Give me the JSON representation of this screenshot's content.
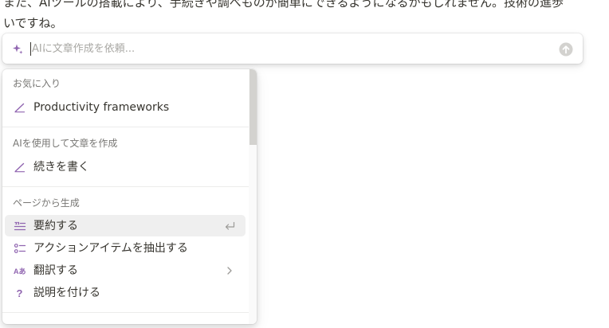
{
  "document": {
    "line1": "また、AIツールの搭載により、手続きや調べものが簡単にできるようになるかもしれません。技術の進歩",
    "line2": "いですね。"
  },
  "ai_bar": {
    "placeholder": "AIに文章作成を依頼...",
    "value": "",
    "icon": "sparkle-icon",
    "send_icon": "arrow-up-circle-icon"
  },
  "menu": {
    "sections": [
      {
        "label": "お気に入り",
        "items": [
          {
            "label": "Productivity frameworks",
            "icon": "pen-icon"
          }
        ]
      },
      {
        "label": "AIを使用して文章を作成",
        "items": [
          {
            "label": "続きを書く",
            "icon": "pen-icon"
          }
        ]
      },
      {
        "label": "ページから生成",
        "items": [
          {
            "label": "要約する",
            "icon": "quote-list-icon",
            "trailing": "enter-icon",
            "active": true
          },
          {
            "label": "アクションアイテムを抽出する",
            "icon": "checklist-icon"
          },
          {
            "label": "翻訳する",
            "icon": "translate-icon",
            "trailing": "chevron-right-icon"
          },
          {
            "label": "説明を付ける",
            "icon": "question-icon"
          }
        ]
      }
    ]
  },
  "colors": {
    "accent_purple": "#9065b0",
    "active_row": "#efefef",
    "text": "#37352f",
    "muted": "#787774"
  }
}
